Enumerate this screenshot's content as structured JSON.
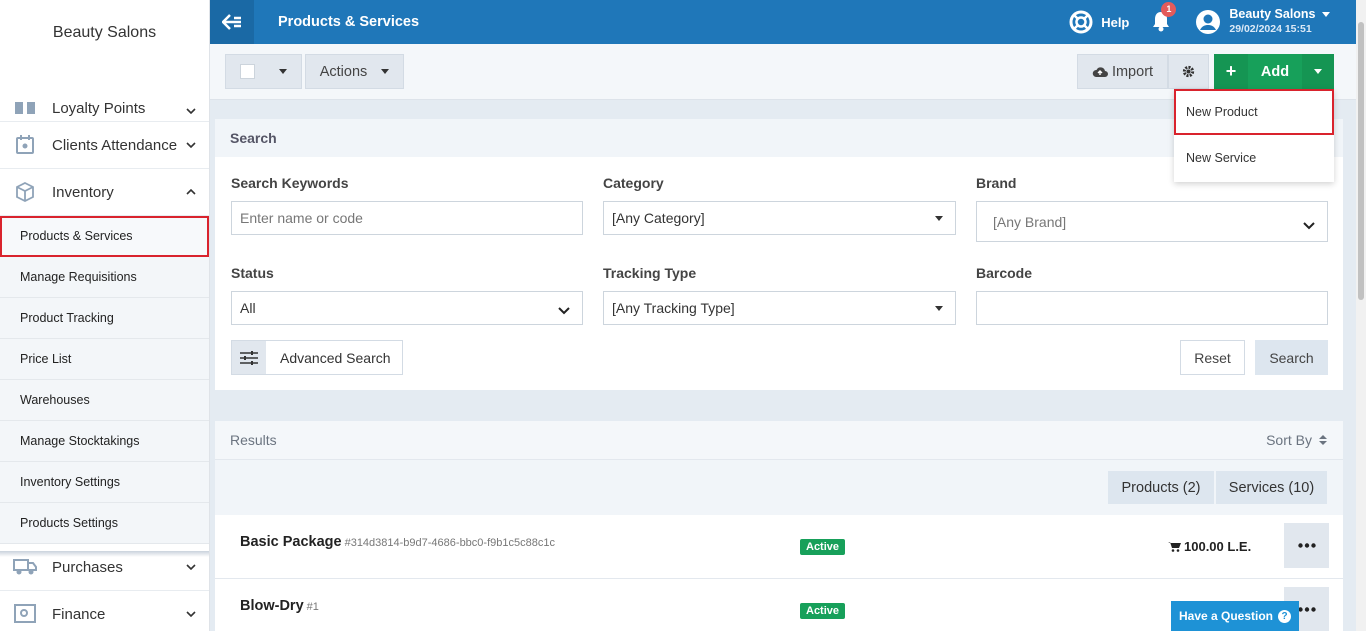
{
  "colors": {
    "topbar": "#1f77b9",
    "accent_green": "#17a05a",
    "highlight_red": "#d9232d"
  },
  "sidebar": {
    "brand": "Beauty Salons",
    "menu": [
      {
        "label": "Loyalty Points",
        "icon": "gift-icon"
      },
      {
        "label": "Clients Attendance",
        "icon": "calendar-icon"
      },
      {
        "label": "Inventory",
        "icon": "box-icon"
      }
    ],
    "inventory_items": [
      "Products & Services",
      "Manage Requisitions",
      "Product Tracking",
      "Price List",
      "Warehouses",
      "Manage Stocktakings",
      "Inventory Settings",
      "Products Settings"
    ],
    "menu_after": [
      {
        "label": "Purchases",
        "icon": "truck-icon"
      },
      {
        "label": "Finance",
        "icon": "safe-icon"
      }
    ]
  },
  "topbar": {
    "title": "Products & Services",
    "help": "Help",
    "notifications": "1",
    "user_name": "Beauty Salons",
    "user_date": "29/02/2024 15:51"
  },
  "toolbar": {
    "actions": "Actions",
    "import": "Import",
    "add": "Add",
    "add_menu": [
      "New Product",
      "New Service"
    ]
  },
  "search": {
    "title": "Search",
    "keywords_label": "Search Keywords",
    "keywords_placeholder": "Enter name or code",
    "category_label": "Category",
    "category_value": "[Any Category]",
    "brand_label": "Brand",
    "brand_value": "[Any Brand]",
    "status_label": "Status",
    "status_value": "All",
    "tracking_label": "Tracking Type",
    "tracking_value": "[Any Tracking Type]",
    "barcode_label": "Barcode",
    "advanced": "Advanced Search",
    "reset": "Reset",
    "search_btn": "Search"
  },
  "results": {
    "title": "Results",
    "sort_by": "Sort By",
    "tab_products": "Products (2)",
    "tab_services": "Services (10)",
    "rows": [
      {
        "name": "Basic Package",
        "code": "#314d3814-b9d7-4686-bbc0-f9b1c5c88c1c",
        "status": "Active",
        "price": "100.00 L.E."
      },
      {
        "name": "Blow-Dry",
        "code": "#1",
        "status": "Active",
        "price": ""
      }
    ]
  },
  "question": "Have a Question"
}
